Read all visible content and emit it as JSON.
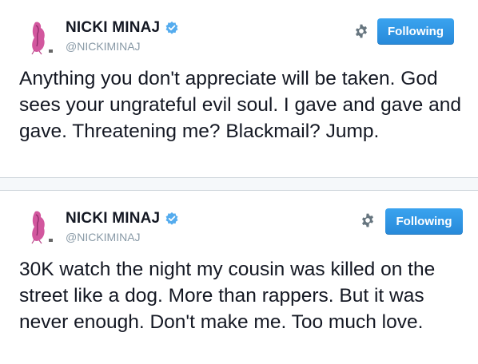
{
  "colors": {
    "follow_button": "#2b96e8",
    "verified_badge": "#55acee",
    "handle_text": "#8899a6",
    "tweet_text": "#141823",
    "separator_bg": "#f5f8fa",
    "avatar_accent": "#d2579e"
  },
  "tweets": [
    {
      "name": "NICKI MINAJ",
      "handle": "@NICKIMINAJ",
      "verified_icon": "verified-badge-icon",
      "settings_icon": "gear-icon",
      "button_label": "Following",
      "text": "Anything you don't appreciate will be taken. God sees your ungrateful evil soul. I gave and gave and gave. Threatening me? Blackmail? Jump."
    },
    {
      "name": "NICKI MINAJ",
      "handle": "@NICKIMINAJ",
      "verified_icon": "verified-badge-icon",
      "settings_icon": "gear-icon",
      "button_label": "Following",
      "text": "30K watch the night my cousin was killed on the street like a dog. More than rappers. But it was never enough. Don't make me. Too much love."
    }
  ]
}
